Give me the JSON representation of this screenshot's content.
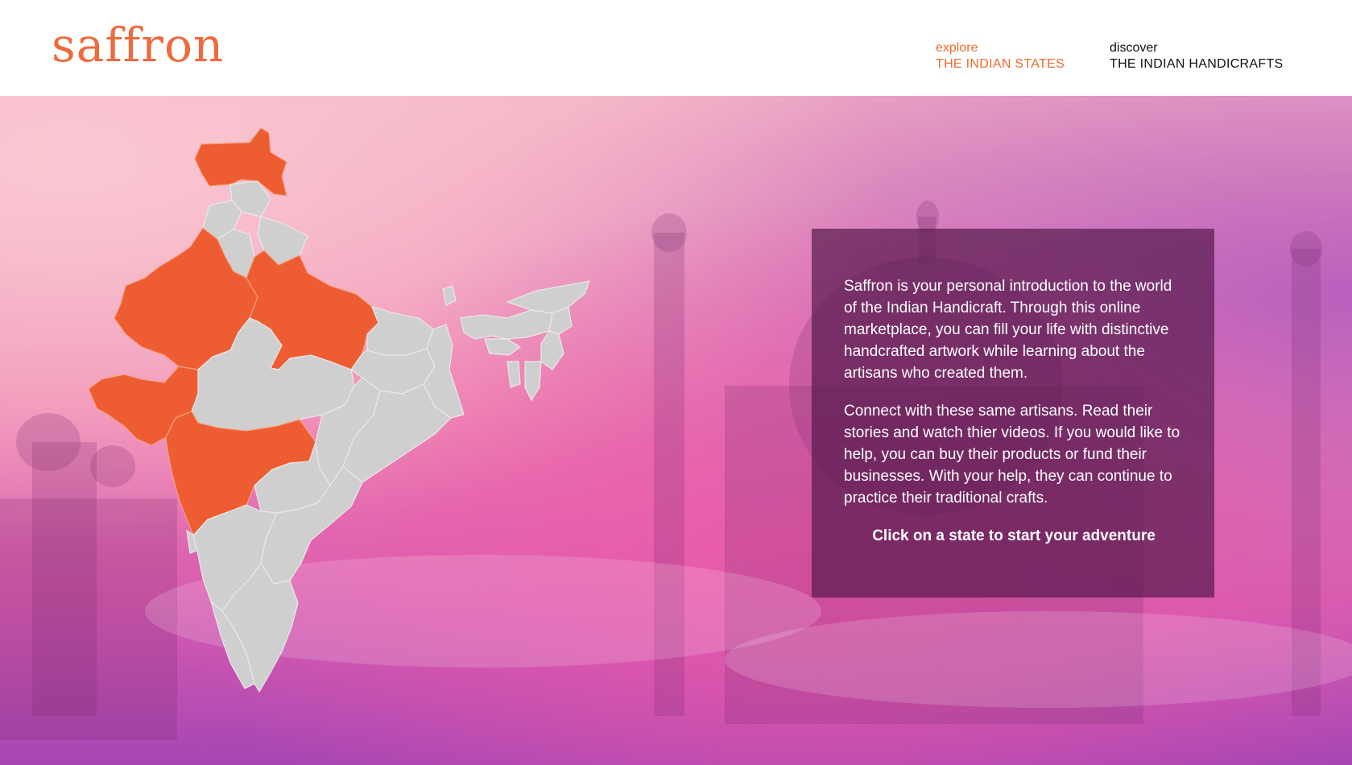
{
  "header": {
    "logo": "saffron",
    "nav": {
      "explore_small": "explore",
      "explore_big": "THE INDIAN STATES",
      "discover_small": "discover",
      "discover_big": "THE INDIAN HANDICRAFTS"
    }
  },
  "colors": {
    "accent": "#ef6a2d",
    "state_highlight": "#ee5d32",
    "state_default": "#cfcfcf",
    "panel_bg": "#52184a"
  },
  "map": {
    "highlighted_states": [
      "Jammu and Kashmir",
      "Rajasthan",
      "Uttar Pradesh",
      "Gujarat",
      "Maharashtra"
    ]
  },
  "info": {
    "paragraph1": "Saffron is your personal introduction to the world of the Indian Handicraft. Through this online marketplace, you can fill your life with distinctive handcrafted artwork while learning about the artisans who created them.",
    "paragraph2": "Connect with these same artisans. Read their stories and watch thier videos. If you would like to help, you can buy their products or fund their businesses. With your help, they can continue to practice their traditional crafts.",
    "cta": "Click on a state to start your adventure"
  }
}
